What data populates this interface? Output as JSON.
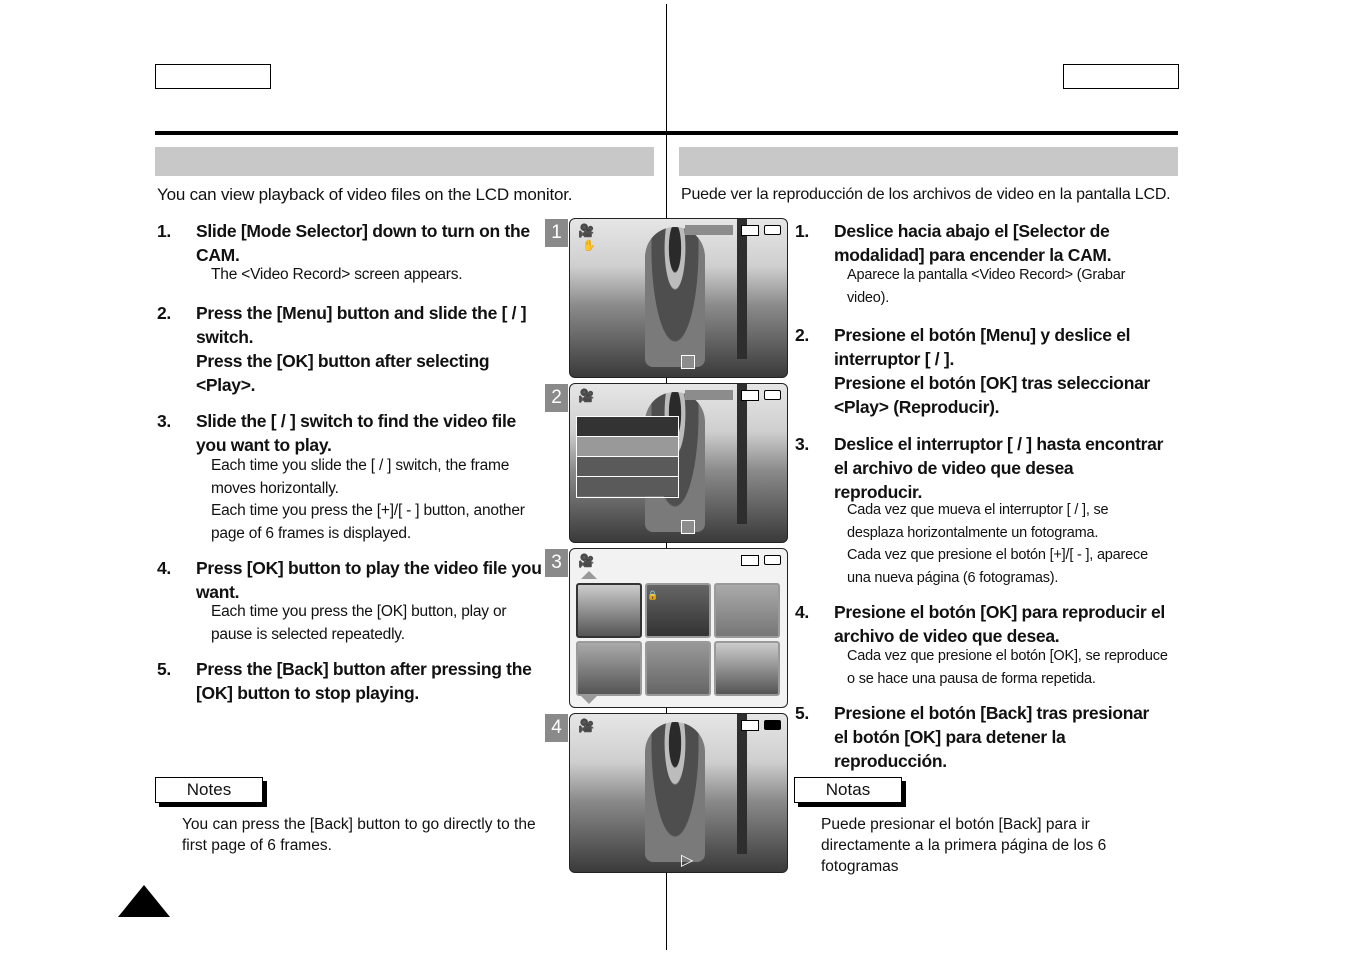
{
  "en": {
    "intro": "You can view playback of video files on the LCD monitor.",
    "steps": [
      {
        "num": "1.",
        "text": "Slide [Mode Selector] down to turn on the CAM.",
        "subs": [
          "The <Video Record> screen appears."
        ]
      },
      {
        "num": "2.",
        "text": "Press the [Menu] button and slide the [    /    ] switch.",
        "text2": "Press the [OK] button after selecting <Play>.",
        "subs": []
      },
      {
        "num": "3.",
        "text": "Slide the [    /    ] switch to find the video file you want to play.",
        "subs": [
          "Each time you slide the [    /    ] switch, the frame moves horizontally.",
          "Each time you press the [+]/[ - ] button, another page of 6 frames is displayed."
        ]
      },
      {
        "num": "4.",
        "text": "Press [OK] button to play the video file you want.",
        "subs": [
          "Each time you press the [OK] button, play or pause is selected repeatedly."
        ]
      },
      {
        "num": "5.",
        "text": "Press the [Back] button after pressing the [OK] button to stop playing.",
        "subs": []
      }
    ],
    "notes_label": "Notes",
    "notes_text": "You can press the [Back] button to go directly to the first page of 6 frames."
  },
  "es": {
    "intro": "Puede ver la reproducción de los archivos de video en la pantalla LCD.",
    "steps": [
      {
        "num": "1.",
        "text": "Deslice hacia abajo el [Selector de modalidad] para encender la CAM.",
        "subs": [
          "Aparece la pantalla <Video Record> (Grabar video)."
        ]
      },
      {
        "num": "2.",
        "text": "Presione el botón [Menu] y deslice el interruptor [    /    ].",
        "text2": "Presione el botón [OK] tras seleccionar <Play> (Reproducir).",
        "subs": []
      },
      {
        "num": "3.",
        "text": "Deslice el interruptor [    /    ] hasta encontrar el archivo de video que desea reproducir.",
        "subs": [
          "Cada vez que mueva el interruptor [    /    ], se desplaza horizontalmente un fotograma.",
          "Cada vez que presione el botón [+]/[ - ], aparece una nueva página (6 fotogramas)."
        ]
      },
      {
        "num": "4.",
        "text": "Presione el botón [OK] para reproducir el archivo de video que desea.",
        "subs": [
          "Cada vez que presione el botón [OK], se reproduce o se hace una pausa de forma repetida."
        ]
      },
      {
        "num": "5.",
        "text": "Presione el botón [Back] tras presionar el botón [OK] para detener la reproducción.",
        "subs": []
      }
    ],
    "notes_label": "Notas",
    "notes_text": "Puede presionar el botón [Back] para ir directamente a la primera página de los 6 fotogramas"
  },
  "screens": {
    "badges": [
      "1",
      "2",
      "3",
      "4"
    ],
    "icons": [
      "camcorder-icon",
      "stabilizer-icon",
      "memory-card-icon",
      "battery-icon",
      "lock-icon",
      "play-icon"
    ]
  }
}
